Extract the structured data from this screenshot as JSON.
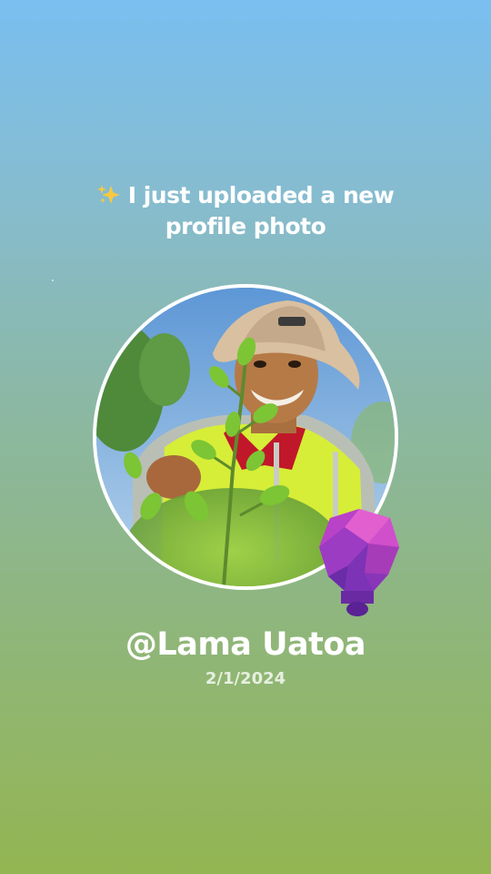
{
  "post": {
    "headline_line1": "I just uploaded a new",
    "headline_line2": "profile photo",
    "sparkle_icon": "sparkles-icon"
  },
  "profile": {
    "username": "@Lama Uatoa",
    "date": "2/1/2024",
    "photo": "profile-photo-man-in-bucket-hat-hi-vis-vest-among-plants"
  },
  "badge": {
    "icon": "lightbulb-gem-icon",
    "colors": [
      "#d64fc4",
      "#8a3ab0",
      "#5a2a9a"
    ]
  },
  "colors": {
    "background_top": "#79bff0",
    "background_bottom": "#93b552",
    "text": "#ffffff"
  }
}
